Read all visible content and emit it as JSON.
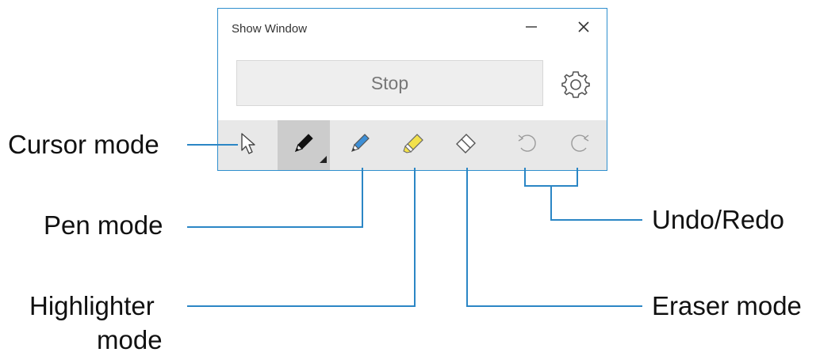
{
  "window": {
    "title": "Show Window",
    "minimize_icon": "minimize-icon",
    "close_icon": "close-icon",
    "stop_label": "Stop",
    "settings_icon": "gear-icon",
    "border_color": "#2f8fce"
  },
  "toolbar": {
    "tools": [
      {
        "name": "cursor",
        "icon": "cursor-icon",
        "active": false
      },
      {
        "name": "pen-black",
        "icon": "pen-icon",
        "active": true
      },
      {
        "name": "pen-blue",
        "icon": "pen-icon",
        "color": "#3d8fd6",
        "active": false
      },
      {
        "name": "highlighter",
        "icon": "highlighter-icon",
        "color": "#f2e14c",
        "active": false
      },
      {
        "name": "eraser",
        "icon": "eraser-icon",
        "active": false
      },
      {
        "name": "undo",
        "icon": "undo-icon",
        "active": false
      },
      {
        "name": "redo",
        "icon": "redo-icon",
        "active": false
      }
    ]
  },
  "callouts": {
    "cursor_mode": "Cursor mode",
    "pen_mode": "Pen mode",
    "highlighter_line1": "Highlighter",
    "highlighter_line2": "mode",
    "undo_redo": "Undo/Redo",
    "eraser_mode": "Eraser mode",
    "line_color": "#2b86c5"
  }
}
